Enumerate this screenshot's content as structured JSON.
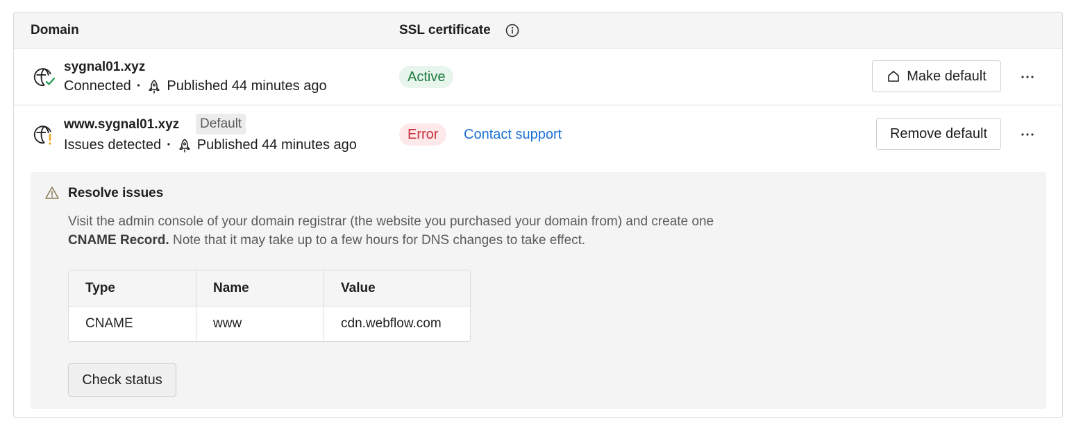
{
  "header": {
    "domain_col": "Domain",
    "ssl_col": "SSL certificate",
    "info_icon": "info-icon"
  },
  "domains": [
    {
      "name": "sygnal01.xyz",
      "status": "Connected",
      "separator": "·",
      "published": "Published 44 minutes ago",
      "ssl_status": "Active",
      "action_label": "Make default",
      "status_icon": "globe-check-icon",
      "colors": {
        "ssl_bg": "#e7f5ec",
        "ssl_fg": "#1c7a3c",
        "check": "#1c9a4c"
      }
    },
    {
      "name": "www.sygnal01.xyz",
      "tag": "Default",
      "status": "Issues detected",
      "separator": "·",
      "published": "Published 44 minutes ago",
      "ssl_status": "Error",
      "support_link": "Contact support",
      "action_label": "Remove default",
      "status_icon": "globe-warning-icon",
      "colors": {
        "ssl_bg": "#fde8ea",
        "ssl_fg": "#c8323c",
        "warning": "#e8a317",
        "link": "#1a6fd6"
      }
    }
  ],
  "resolve": {
    "title": "Resolve issues",
    "desc_part1": "Visit the admin console of your domain registrar (the website you purchased your domain from) and create one",
    "desc_bold": "CNAME Record.",
    "desc_part2": " Note that it may take up to a few hours for DNS changes to take effect.",
    "table": {
      "headers": [
        "Type",
        "Name",
        "Value"
      ],
      "rows": [
        [
          "CNAME",
          "www",
          "cdn.webflow.com"
        ]
      ]
    },
    "check_label": "Check status"
  }
}
